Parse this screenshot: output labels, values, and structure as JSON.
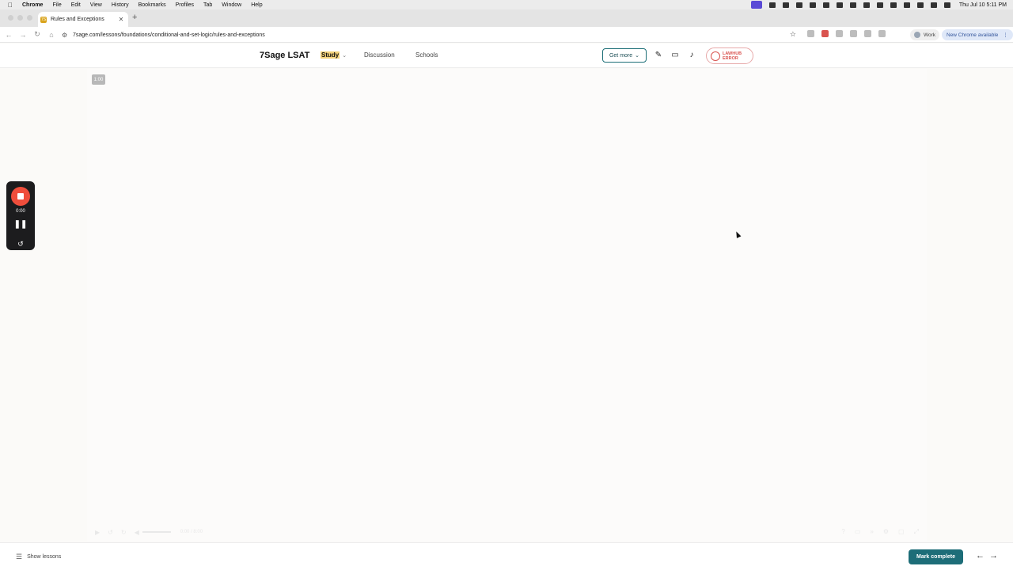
{
  "menubar": {
    "apple": "",
    "items": [
      "Chrome",
      "File",
      "Edit",
      "View",
      "History",
      "Bookmarks",
      "Profiles",
      "Tab",
      "Window",
      "Help"
    ],
    "clock": "Thu Jul 10  5:11 PM"
  },
  "browser": {
    "tab_title": "Rules and Exceptions",
    "tab_favicon": "7S",
    "new_tab": "+",
    "url": "7sage.com/lessons/foundations/conditional-and-set-logic/rules-and-exceptions",
    "profile": "Work",
    "update_label": "New Chrome available",
    "update_menu": "⋮"
  },
  "site": {
    "logo": "7Sage LSAT",
    "nav": {
      "study": "Study",
      "discussion": "Discussion",
      "schools": "Schools"
    },
    "get_more": "Get more",
    "lawhub_line1": "LAWHUB",
    "lawhub_line2": "ERROR"
  },
  "video": {
    "time_badge": "1:00",
    "controls_time": "0:00 / 8:00"
  },
  "recorder": {
    "time": "0:00"
  },
  "footer": {
    "show_lessons": "Show lessons",
    "mark_complete": "Mark complete"
  },
  "colors": {
    "accent_teal": "#1d6d78",
    "record_red": "#ef4e3c",
    "study_highlight": "#f4d27a",
    "lawhub_red": "#d9534f"
  }
}
